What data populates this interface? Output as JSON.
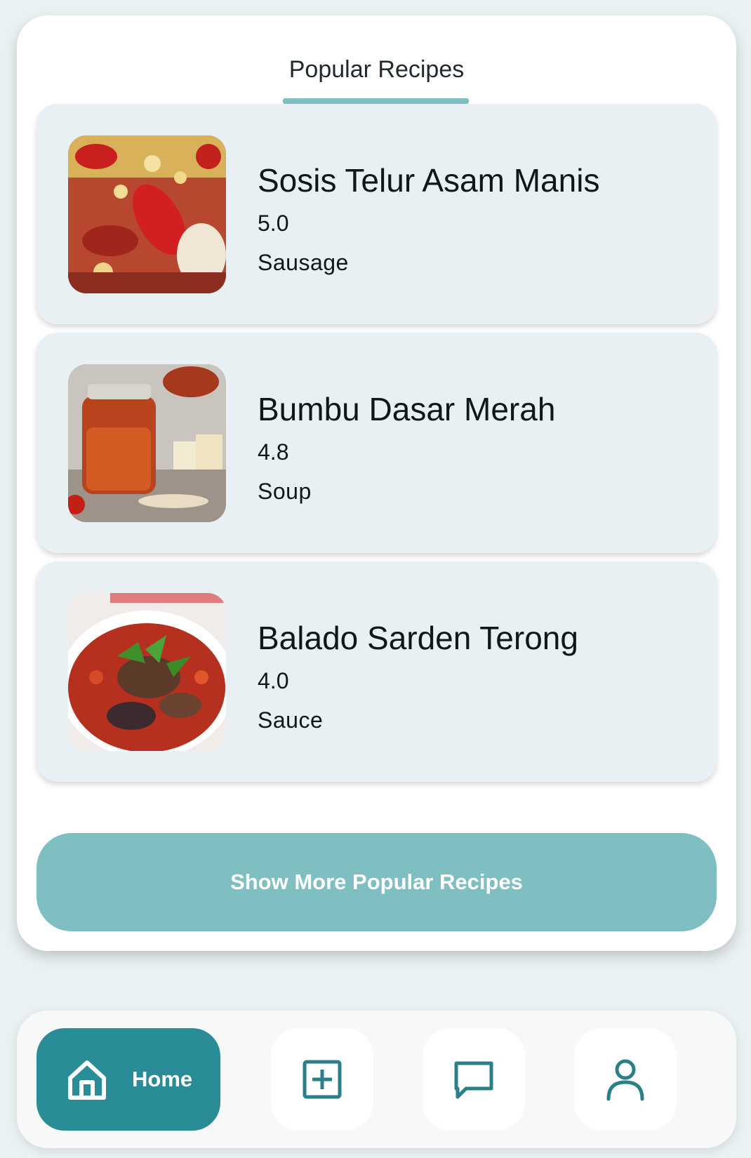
{
  "section": {
    "tab_title": "Popular Recipes"
  },
  "recipes": [
    {
      "name": "Sosis Telur Asam Manis",
      "rating": "5.0",
      "category": "Sausage"
    },
    {
      "name": "Bumbu Dasar Merah",
      "rating": "4.8",
      "category": "Soup"
    },
    {
      "name": "Balado Sarden Terong",
      "rating": "4.0",
      "category": "Sauce"
    }
  ],
  "show_more_label": "Show More Popular Recipes",
  "bottom_nav": {
    "home_label": "Home",
    "items": [
      "home-icon",
      "add-square-icon",
      "chat-bubble-icon",
      "user-icon"
    ]
  },
  "colors": {
    "accent": "#7fbec1",
    "nav_active": "#2a8c96",
    "card_bg": "#e9f0f4",
    "icon": "#2a7f88"
  }
}
